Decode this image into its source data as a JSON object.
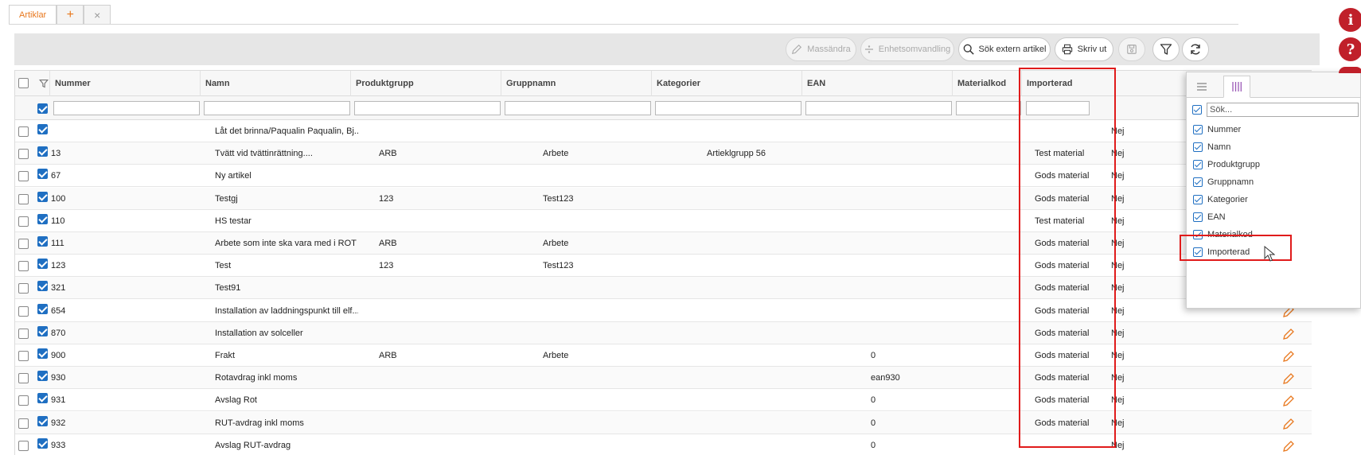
{
  "tabs": {
    "active": "Artiklar",
    "add": "+",
    "close": "×"
  },
  "toolbar": {
    "mass_edit": "Massändra",
    "unit_conversion": "Enhetsomvandling",
    "search_external": "Sök extern artikel",
    "print": "Skriv ut"
  },
  "columns": {
    "nummer": "Nummer",
    "namn": "Namn",
    "produktgrupp": "Produktgrupp",
    "gruppnamn": "Gruppnamn",
    "kategorier": "Kategorier",
    "ean": "EAN",
    "materialkod": "Materialkod",
    "importerad": "Importerad"
  },
  "rows": [
    {
      "nummer": "",
      "namn": "Låt det brinna/Paqualin Paqualin, Bj...",
      "produktgrupp": "",
      "gruppnamn": "",
      "kategorier": "",
      "ean": "",
      "materialkod": "",
      "importerad": "Nej"
    },
    {
      "nummer": "13",
      "namn": "Tvätt vid tvättinrättning....",
      "produktgrupp": "ARB",
      "gruppnamn": "Arbete",
      "kategorier": "Artieklgrupp 56",
      "ean": "",
      "materialkod": "Test material",
      "importerad": "Nej"
    },
    {
      "nummer": "67",
      "namn": "Ny artikel",
      "produktgrupp": "",
      "gruppnamn": "",
      "kategorier": "",
      "ean": "",
      "materialkod": "Gods material",
      "importerad": "Nej"
    },
    {
      "nummer": "100",
      "namn": "Testgj",
      "produktgrupp": "123",
      "gruppnamn": "Test123",
      "kategorier": "",
      "ean": "",
      "materialkod": "Gods material",
      "importerad": "Nej"
    },
    {
      "nummer": "110",
      "namn": "HS testar",
      "produktgrupp": "",
      "gruppnamn": "",
      "kategorier": "",
      "ean": "",
      "materialkod": "Test material",
      "importerad": "Nej"
    },
    {
      "nummer": "111",
      "namn": "Arbete som inte ska vara med i ROT",
      "produktgrupp": "ARB",
      "gruppnamn": "Arbete",
      "kategorier": "",
      "ean": "",
      "materialkod": "Gods material",
      "importerad": "Nej"
    },
    {
      "nummer": "123",
      "namn": "Test",
      "produktgrupp": "123",
      "gruppnamn": "Test123",
      "kategorier": "",
      "ean": "",
      "materialkod": "Gods material",
      "importerad": "Nej"
    },
    {
      "nummer": "321",
      "namn": "Test91",
      "produktgrupp": "",
      "gruppnamn": "",
      "kategorier": "",
      "ean": "",
      "materialkod": "Gods material",
      "importerad": "Nej"
    },
    {
      "nummer": "654",
      "namn": "Installation av laddningspunkt till elf...",
      "produktgrupp": "",
      "gruppnamn": "",
      "kategorier": "",
      "ean": "",
      "materialkod": "Gods material",
      "importerad": "Nej"
    },
    {
      "nummer": "870",
      "namn": "Installation av solceller",
      "produktgrupp": "",
      "gruppnamn": "",
      "kategorier": "",
      "ean": "",
      "materialkod": "Gods material",
      "importerad": "Nej"
    },
    {
      "nummer": "900",
      "namn": "Frakt",
      "produktgrupp": "ARB",
      "gruppnamn": "Arbete",
      "kategorier": "",
      "ean": "0",
      "materialkod": "Gods material",
      "importerad": "Nej"
    },
    {
      "nummer": "930",
      "namn": "Rotavdrag inkl moms",
      "produktgrupp": "",
      "gruppnamn": "",
      "kategorier": "",
      "ean": "ean930",
      "materialkod": "Gods material",
      "importerad": "Nej"
    },
    {
      "nummer": "931",
      "namn": "Avslag Rot",
      "produktgrupp": "",
      "gruppnamn": "",
      "kategorier": "",
      "ean": "0",
      "materialkod": "Gods material",
      "importerad": "Nej"
    },
    {
      "nummer": "932",
      "namn": "RUT-avdrag inkl moms",
      "produktgrupp": "",
      "gruppnamn": "",
      "kategorier": "",
      "ean": "0",
      "materialkod": "Gods material",
      "importerad": "Nej"
    },
    {
      "nummer": "933",
      "namn": "Avslag RUT-avdrag",
      "produktgrupp": "",
      "gruppnamn": "",
      "kategorier": "",
      "ean": "0",
      "materialkod": "",
      "importerad": "Nej"
    }
  ],
  "column_panel": {
    "search_placeholder": "Sök...",
    "items": [
      "Nummer",
      "Namn",
      "Produktgrupp",
      "Gruppnamn",
      "Kategorier",
      "EAN",
      "Materialkod",
      "Importerad"
    ]
  },
  "side_icons": {
    "info": "i",
    "help": "?"
  },
  "colors": {
    "accent": "#e8781e",
    "checkbox": "#1f6fc2",
    "highlight": "#e01b1b",
    "side_icon": "#c0202a"
  }
}
